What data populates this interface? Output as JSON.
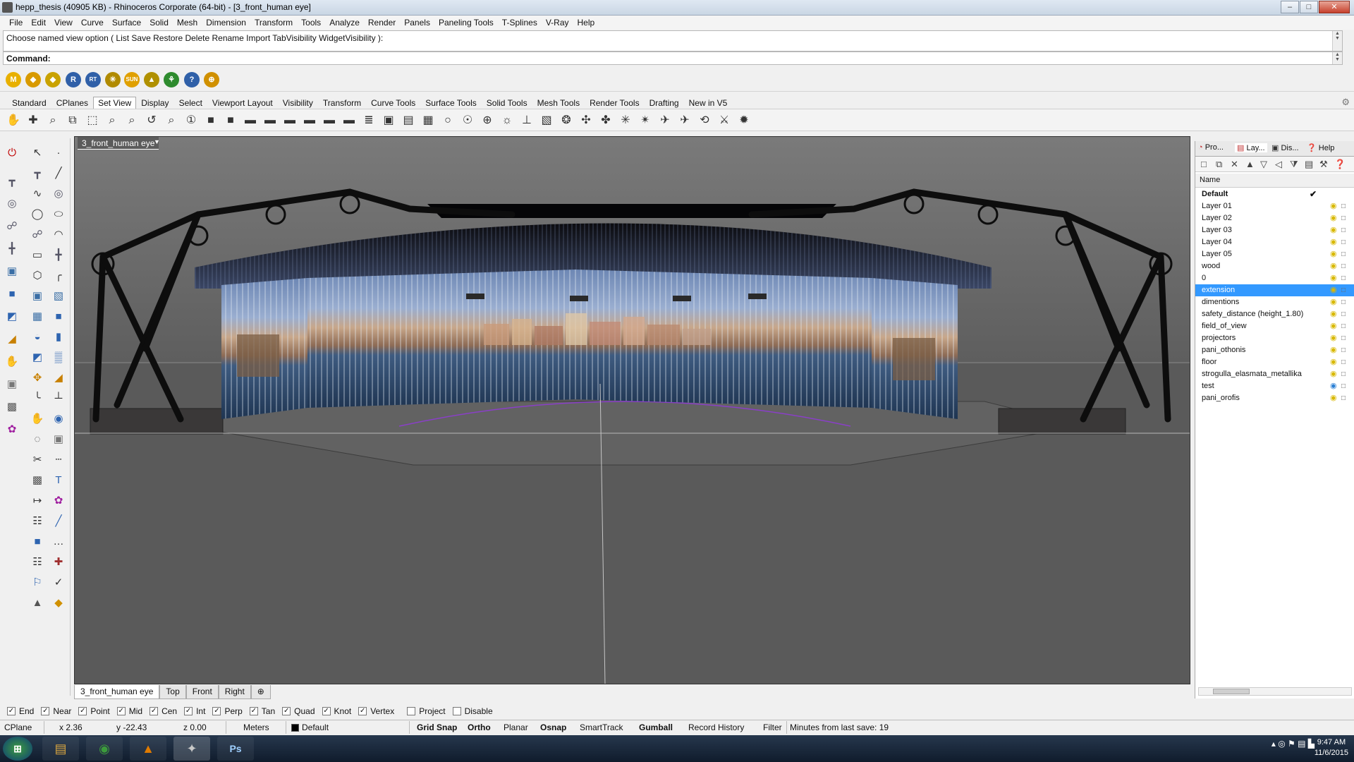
{
  "window": {
    "title": "hepp_thesis (40905 KB) - Rhinoceros Corporate (64-bit) - [3_front_human eye]",
    "min": "–",
    "max": "□",
    "close": "✕"
  },
  "menu": [
    "File",
    "Edit",
    "View",
    "Curve",
    "Surface",
    "Solid",
    "Mesh",
    "Dimension",
    "Transform",
    "Tools",
    "Analyze",
    "Render",
    "Panels",
    "Paneling Tools",
    "T-Splines",
    "V-Ray",
    "Help"
  ],
  "command": {
    "history": "Choose named view option ( List  Save  Restore  Delete  Rename  Import  TabVisibility  WidgetVisibility ):",
    "prompt": "Command:"
  },
  "plugins": [
    {
      "icon": "vray-m-icon",
      "glyph": "M",
      "color": "#e8b000"
    },
    {
      "icon": "vray-tag-icon",
      "glyph": "◆",
      "color": "#d89a00"
    },
    {
      "icon": "vray-material-icon",
      "glyph": "◆",
      "color": "#c9a200"
    },
    {
      "icon": "vray-render-icon",
      "glyph": "R",
      "color": "#3060a8"
    },
    {
      "icon": "vray-rt-icon",
      "glyph": "RT",
      "color": "#3060a8"
    },
    {
      "icon": "vray-light-icon",
      "glyph": "✳",
      "color": "#b08a00"
    },
    {
      "icon": "vray-sun-icon",
      "glyph": "SUN",
      "color": "#e0a000"
    },
    {
      "icon": "vray-dome-icon",
      "glyph": "▲",
      "color": "#b09000"
    },
    {
      "icon": "vray-fur-icon",
      "glyph": "⚘",
      "color": "#2e8b2e"
    },
    {
      "icon": "vray-help-icon",
      "glyph": "?",
      "color": "#3060a8"
    },
    {
      "icon": "vray-globe-icon",
      "glyph": "⊕",
      "color": "#d09000"
    }
  ],
  "toolbar_tabs": [
    "Standard",
    "CPlanes",
    "Set View",
    "Display",
    "Select",
    "Viewport Layout",
    "Visibility",
    "Transform",
    "Curve Tools",
    "Surface Tools",
    "Solid Tools",
    "Mesh Tools",
    "Render Tools",
    "Drafting",
    "New in V5"
  ],
  "toolbar_active_tab": "Set View",
  "toolbar_icons": [
    {
      "name": "pan-icon",
      "glyph": "✋"
    },
    {
      "name": "rotate-view-icon",
      "glyph": "✚"
    },
    {
      "name": "zoom-icon",
      "glyph": "⌕"
    },
    {
      "name": "zoom-extents-icon",
      "glyph": "⧉"
    },
    {
      "name": "zoom-window-icon",
      "glyph": "⬚"
    },
    {
      "name": "zoom-selected-icon",
      "glyph": "⌕"
    },
    {
      "name": "zoom-target-icon",
      "glyph": "⌕"
    },
    {
      "name": "undo-view-icon",
      "glyph": "↺"
    },
    {
      "name": "zoom-lens-icon",
      "glyph": "⌕"
    },
    {
      "name": "zoom-1to1-icon",
      "glyph": "①"
    },
    {
      "name": "cplane-top-icon",
      "glyph": "■"
    },
    {
      "name": "cplane-front-icon",
      "glyph": "■"
    },
    {
      "name": "car-top-icon",
      "glyph": "▬"
    },
    {
      "name": "car-front-icon",
      "glyph": "▬"
    },
    {
      "name": "car-right-icon",
      "glyph": "▬"
    },
    {
      "name": "car-left-icon",
      "glyph": "▬"
    },
    {
      "name": "car-perspective-icon",
      "glyph": "▬"
    },
    {
      "name": "car-3d-icon",
      "glyph": "▬"
    },
    {
      "name": "named-view-icon",
      "glyph": "≣"
    },
    {
      "name": "camera-icon",
      "glyph": "▣"
    },
    {
      "name": "print-view-icon",
      "glyph": "▤"
    },
    {
      "name": "viewport-layout-icon",
      "glyph": "▦"
    },
    {
      "name": "sphere-icon",
      "glyph": "○"
    },
    {
      "name": "lens-icon",
      "glyph": "☉"
    },
    {
      "name": "target-icon",
      "glyph": "⊕"
    },
    {
      "name": "sun-target-icon",
      "glyph": "☼"
    },
    {
      "name": "plumb-icon",
      "glyph": "⊥"
    },
    {
      "name": "set-camera-icon",
      "glyph": "▧"
    },
    {
      "name": "walkabout-icon",
      "glyph": "❂"
    },
    {
      "name": "cross-arrows-icon",
      "glyph": "✣"
    },
    {
      "name": "split-view-icon",
      "glyph": "✤"
    },
    {
      "name": "sun-icon",
      "glyph": "✳"
    },
    {
      "name": "star-icon",
      "glyph": "✴"
    },
    {
      "name": "fly-icon",
      "glyph": "✈"
    },
    {
      "name": "plane-icon",
      "glyph": "✈"
    },
    {
      "name": "orbit-icon",
      "glyph": "⟲"
    },
    {
      "name": "walk-icon",
      "glyph": "⚔"
    },
    {
      "name": "sparkle-icon",
      "glyph": "✹"
    }
  ],
  "left_tools": [
    {
      "name": "stop-icon",
      "glyph": "⏻",
      "color": "#c00000"
    },
    {
      "name": "select-arrow-icon",
      "glyph": "↖",
      "color": "#333"
    },
    {
      "name": "point-icon",
      "glyph": "·",
      "color": "#333"
    },
    {
      "name": "axes-icon",
      "glyph": "┳",
      "color": "#556"
    },
    {
      "name": "polyline-icon",
      "glyph": "╱",
      "color": "#333"
    },
    {
      "name": "curve-icon",
      "glyph": "∿",
      "color": "#333"
    },
    {
      "name": "globe-icon",
      "glyph": "◎",
      "color": "#556"
    },
    {
      "name": "circle-icon",
      "glyph": "◯",
      "color": "#333"
    },
    {
      "name": "ellipse-icon",
      "glyph": "⬭",
      "color": "#333"
    },
    {
      "name": "network-icon",
      "glyph": "☍",
      "color": "#556"
    },
    {
      "name": "arc-icon",
      "glyph": "◠",
      "color": "#333"
    },
    {
      "name": "rectangle-icon",
      "glyph": "▭",
      "color": "#333"
    },
    {
      "name": "grid-axes-icon",
      "glyph": "╋",
      "color": "#556"
    },
    {
      "name": "polygon-icon",
      "glyph": "⬡",
      "color": "#333"
    },
    {
      "name": "fillet-icon",
      "glyph": "╭",
      "color": "#333"
    },
    {
      "name": "box-icon",
      "glyph": "▣",
      "color": "#3a6ea5"
    },
    {
      "name": "surface-icon",
      "glyph": "▧",
      "color": "#3a6ea5"
    },
    {
      "name": "loft-icon",
      "glyph": "▦",
      "color": "#3a6ea5"
    },
    {
      "name": "solid-box-icon",
      "glyph": "■",
      "color": "#2e64b0"
    },
    {
      "name": "solid-union-icon",
      "glyph": "◒",
      "color": "#2e64b0"
    },
    {
      "name": "cylinder-icon",
      "glyph": "▮",
      "color": "#2e64b0"
    },
    {
      "name": "extrude-icon",
      "glyph": "◩",
      "color": "#2e64b0"
    },
    {
      "name": "mesh-icon",
      "glyph": "▒",
      "color": "#2e64b0"
    },
    {
      "name": "transform-icon",
      "glyph": "✥",
      "color": "#c88000"
    },
    {
      "name": "scale-icon",
      "glyph": "◢",
      "color": "#c88000"
    },
    {
      "name": "orient-icon",
      "glyph": "╰",
      "color": "#333"
    },
    {
      "name": "align-icon",
      "glyph": "┴",
      "color": "#333"
    },
    {
      "name": "hand-icon",
      "glyph": "✋",
      "color": "#777"
    },
    {
      "name": "group-icon",
      "glyph": "◉",
      "color": "#2e64b0"
    },
    {
      "name": "ungroup-icon",
      "glyph": "◌",
      "color": "#333"
    },
    {
      "name": "cube-tool-icon",
      "glyph": "▣",
      "color": "#777"
    },
    {
      "name": "trim-icon",
      "glyph": "✂",
      "color": "#333"
    },
    {
      "name": "split-icon",
      "glyph": "┄",
      "color": "#333"
    },
    {
      "name": "gumball-icon",
      "glyph": "▩",
      "color": "#555"
    },
    {
      "name": "text-icon",
      "glyph": "T",
      "color": "#2e64b0"
    },
    {
      "name": "dimension-icon",
      "glyph": "↦",
      "color": "#333"
    },
    {
      "name": "vray-tool-icon",
      "glyph": "✿",
      "color": "#a020a0"
    },
    {
      "name": "array-icon",
      "glyph": "☷",
      "color": "#333"
    },
    {
      "name": "hatch-icon",
      "glyph": "╱",
      "color": "#2e64b0"
    },
    {
      "name": "solid-block-icon",
      "glyph": "■",
      "color": "#2e64b0"
    },
    {
      "name": "dots-icon",
      "glyph": "…",
      "color": "#333"
    },
    {
      "name": "grid-icon",
      "glyph": "☷",
      "color": "#333"
    },
    {
      "name": "plus-icon",
      "glyph": "✚",
      "color": "#a03030"
    },
    {
      "name": "analyze-icon",
      "glyph": "⚐",
      "color": "#2e64b0"
    },
    {
      "name": "check-tool-icon",
      "glyph": "✓",
      "color": "#333"
    },
    {
      "name": "render-icon",
      "glyph": "▲",
      "color": "#555"
    },
    {
      "name": "material-icon",
      "glyph": "◆",
      "color": "#d09000"
    }
  ],
  "viewport": {
    "name": "3_front_human eye",
    "dropdown": "▼"
  },
  "view_tabs": [
    "3_front_human eye",
    "Top",
    "Front",
    "Right"
  ],
  "view_tab_add": "⊕",
  "panel": {
    "tabs": [
      {
        "icon": "properties-icon",
        "label": "Pro..."
      },
      {
        "icon": "layers-icon",
        "label": "Lay..."
      },
      {
        "icon": "display-icon",
        "label": "Dis..."
      },
      {
        "icon": "help-icon",
        "label": "Help"
      }
    ],
    "tools": [
      {
        "name": "new-layer-icon",
        "glyph": "□"
      },
      {
        "name": "new-sublayer-icon",
        "glyph": "⧉"
      },
      {
        "name": "delete-layer-icon",
        "glyph": "✕"
      },
      {
        "name": "move-up-icon",
        "glyph": "▲"
      },
      {
        "name": "move-down-icon",
        "glyph": "▽"
      },
      {
        "name": "move-parent-icon",
        "glyph": "◁"
      },
      {
        "name": "filter-icon",
        "glyph": "⧩"
      },
      {
        "name": "layer-states-icon",
        "glyph": "▤"
      },
      {
        "name": "tools-icon",
        "glyph": "⚒"
      },
      {
        "name": "layer-help-icon",
        "glyph": "❓"
      }
    ],
    "column_name": "Name",
    "layers": [
      {
        "name": "Default",
        "bold": true,
        "current": true,
        "bulb": "yellow"
      },
      {
        "name": "Layer 01",
        "bulb": "yellow"
      },
      {
        "name": "Layer 02",
        "bulb": "yellow"
      },
      {
        "name": "Layer 03",
        "bulb": "yellow"
      },
      {
        "name": "Layer 04",
        "bulb": "yellow"
      },
      {
        "name": "Layer 05",
        "bulb": "yellow"
      },
      {
        "name": "wood",
        "bulb": "yellow"
      },
      {
        "name": "0",
        "bulb": "yellow"
      },
      {
        "name": "extension",
        "selected": true,
        "bulb": "yellow"
      },
      {
        "name": "dimentions",
        "bulb": "yellow"
      },
      {
        "name": "safety_distance (height_1.80)",
        "bulb": "yellow"
      },
      {
        "name": "field_of_view",
        "bulb": "yellow"
      },
      {
        "name": "projectors",
        "bulb": "yellow"
      },
      {
        "name": "pani_othonis",
        "bulb": "yellow"
      },
      {
        "name": "floor",
        "bulb": "yellow"
      },
      {
        "name": "strogulla_elasmata_metallika",
        "bulb": "yellow"
      },
      {
        "name": "test",
        "bulb": "blue"
      },
      {
        "name": "pani_orofis",
        "bulb": "yellow"
      }
    ],
    "check_glyph": "✔",
    "bulb_glyph": "◉",
    "lock_glyph": "□"
  },
  "osnaps": [
    {
      "label": "End",
      "checked": true
    },
    {
      "label": "Near",
      "checked": true
    },
    {
      "label": "Point",
      "checked": true
    },
    {
      "label": "Mid",
      "checked": true
    },
    {
      "label": "Cen",
      "checked": true
    },
    {
      "label": "Int",
      "checked": true
    },
    {
      "label": "Perp",
      "checked": true
    },
    {
      "label": "Tan",
      "checked": true
    },
    {
      "label": "Quad",
      "checked": true
    },
    {
      "label": "Knot",
      "checked": true
    },
    {
      "label": "Vertex",
      "checked": true
    },
    {
      "label": "Project",
      "checked": false
    },
    {
      "label": "Disable",
      "checked": false
    }
  ],
  "status": {
    "cplane": "CPlane",
    "x": "x 2.36",
    "y": "y -22.43",
    "z": "z 0.00",
    "units": "Meters",
    "layer": "Default",
    "grid_snap": "Grid Snap",
    "ortho": "Ortho",
    "planar": "Planar",
    "osnap": "Osnap",
    "smarttrack": "SmartTrack",
    "gumball": "Gumball",
    "record_history": "Record History",
    "filter": "Filter",
    "last_save": "Minutes from last save: 19"
  },
  "taskbar": {
    "start": "⊞",
    "apps": [
      {
        "name": "explorer-icon",
        "glyph": "▤",
        "color": "#d9a640"
      },
      {
        "name": "chrome-icon",
        "glyph": "◉",
        "color": "#3c9a3c"
      },
      {
        "name": "vlc-icon",
        "glyph": "▲",
        "color": "#e07b00"
      },
      {
        "name": "rhino-icon",
        "glyph": "✦",
        "color": "#c8c8c8"
      },
      {
        "name": "photoshop-icon",
        "glyph": "Ps",
        "color": "#1d3f78"
      }
    ],
    "tray": "▴  ◎  ⚑  ▤  ▙",
    "time": "9:47 AM",
    "date": "11/6/2015"
  },
  "colors": {
    "viewport_bg": "#5b5b5b",
    "selection": "#3399ff",
    "accent": "#3a6ea5"
  }
}
